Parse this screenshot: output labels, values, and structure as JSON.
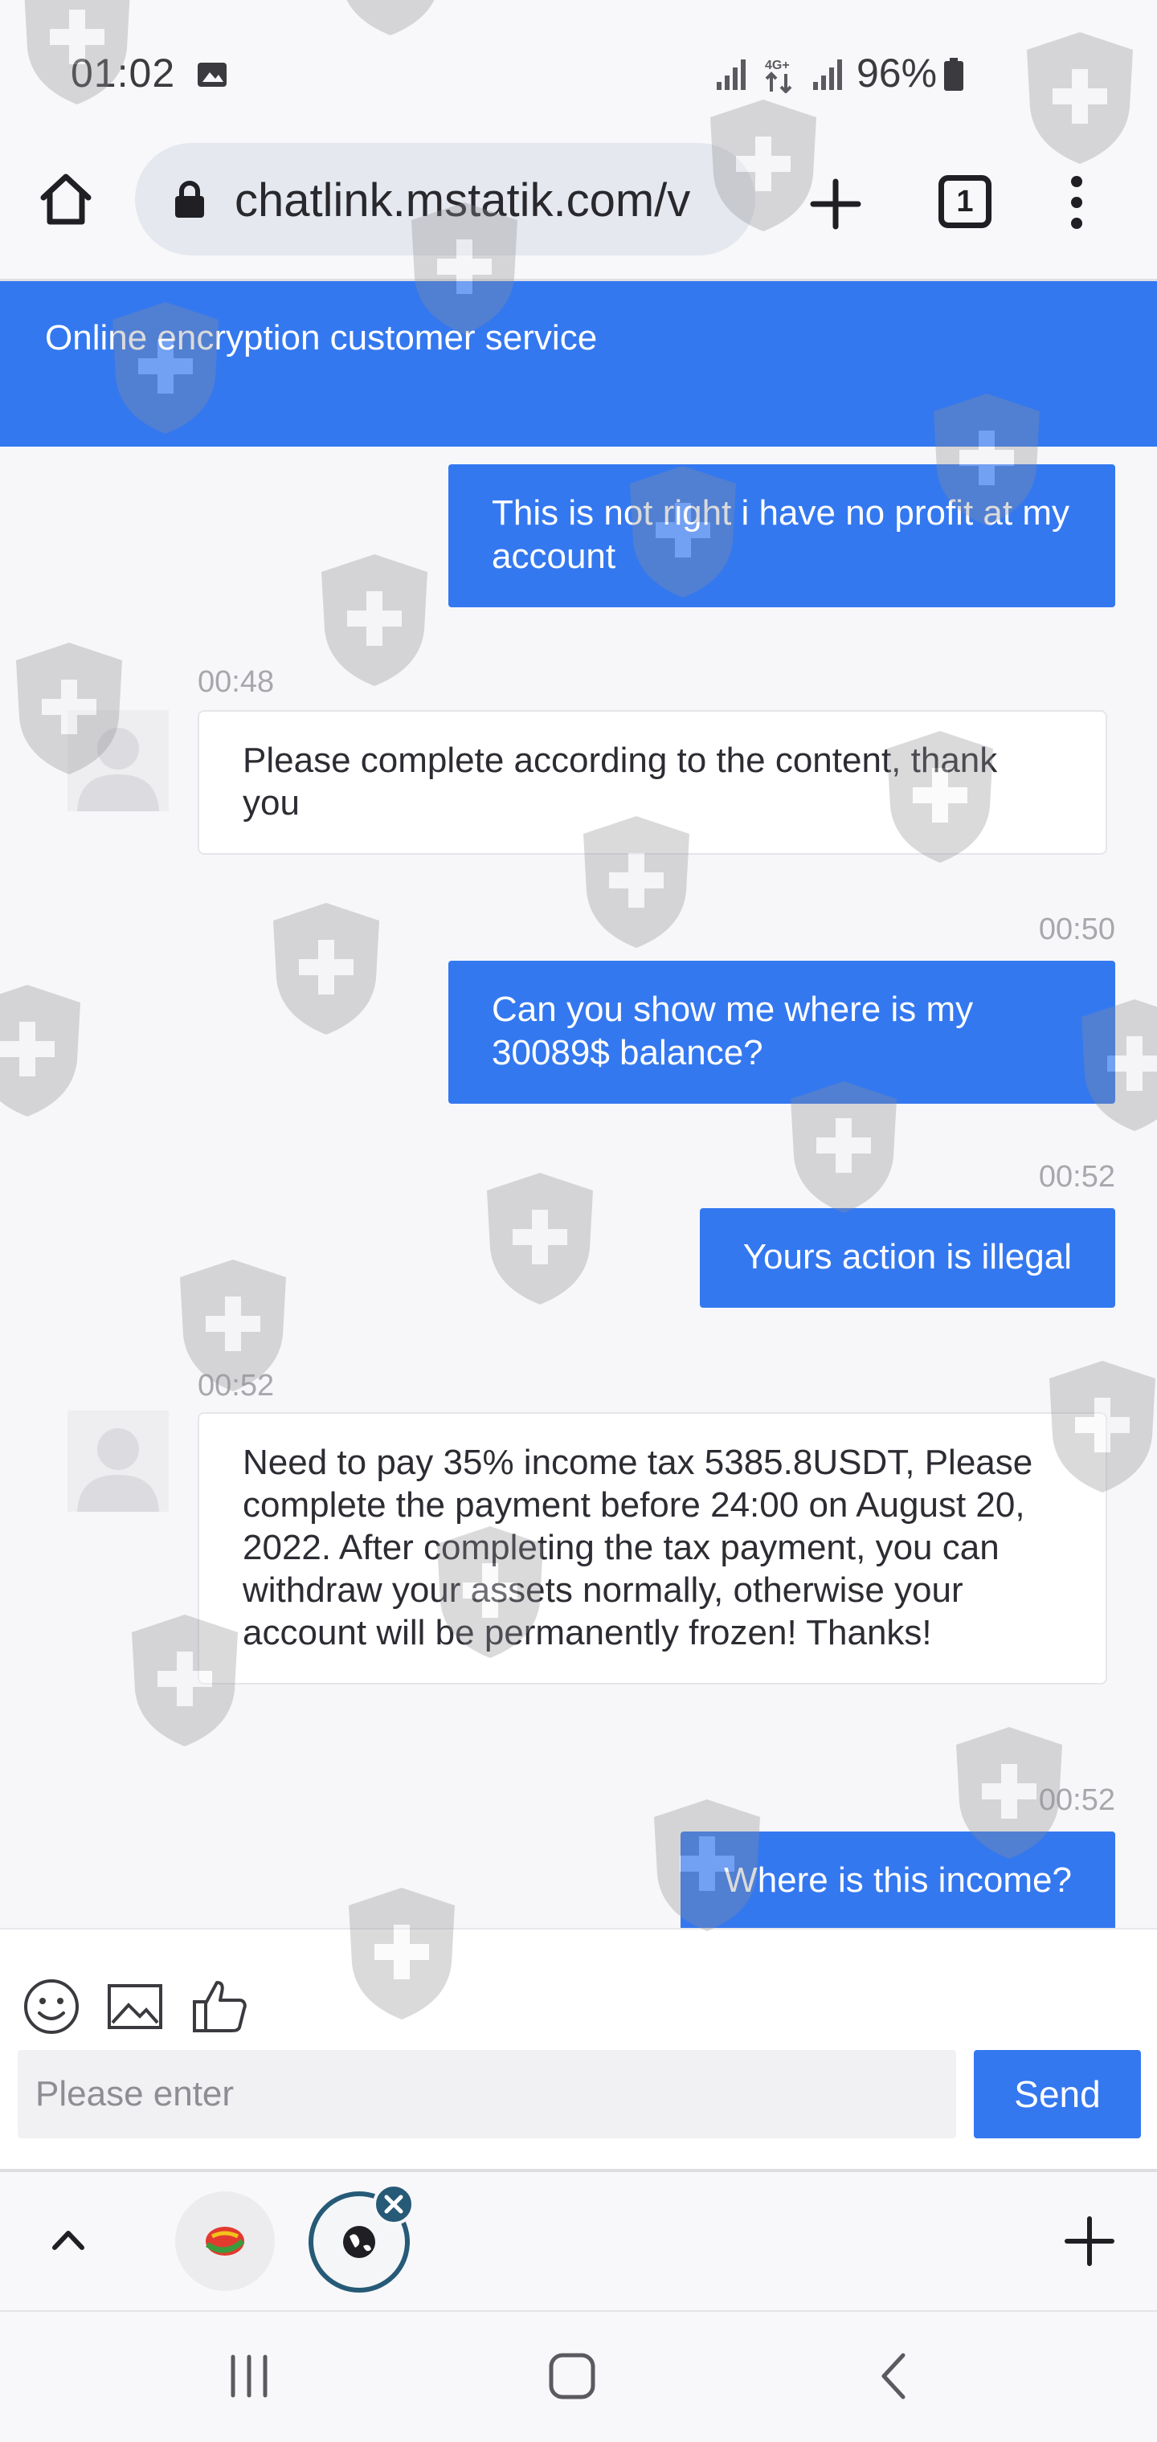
{
  "status_bar": {
    "time": "01:02",
    "battery": "96%",
    "icons": [
      "image-icon",
      "signal-icon",
      "4g-lte-icon",
      "signal-icon",
      "battery-icon"
    ]
  },
  "browser": {
    "url": "chatlink.mstatik.com/v",
    "tab_count": "1",
    "icons": [
      "home-icon",
      "lock-icon",
      "plus-icon",
      "more-vert-icon"
    ]
  },
  "chat": {
    "header_title": "Online encryption customer service",
    "messages": [
      {
        "side": "out",
        "time": "",
        "text": "This is not right i have no profit at my account"
      },
      {
        "side": "in",
        "time": "00:48",
        "text": "Please complete according to the content, thank you"
      },
      {
        "side": "out",
        "time": "00:50",
        "text": "Can you show me where is my 30089$ balance?"
      },
      {
        "side": "out",
        "time": "00:52",
        "text": "Yours action is illegal"
      },
      {
        "side": "in",
        "time": "00:52",
        "text": "Need to pay 35% income tax 5385.8USDT, Please complete the payment before 24:00 on August 20, 2022. After completing the tax payment, you can withdraw your assets normally, otherwise your account will be permanently frozen! Thanks!"
      },
      {
        "side": "out",
        "time": "00:52",
        "text": "Where is this income?"
      }
    ]
  },
  "composer": {
    "placeholder": "Please enter",
    "send_label": "Send",
    "icons": [
      "emoji-icon",
      "image-icon",
      "thumbs-up-icon"
    ]
  },
  "tab_strip": {
    "icons": [
      "chevron-up-icon",
      "site-favicon-icon",
      "globe-icon",
      "close-icon",
      "plus-icon"
    ]
  },
  "nav": {
    "icons": [
      "recent-apps-icon",
      "home-icon",
      "back-icon"
    ]
  },
  "colors": {
    "accent": "#3478f0",
    "tab_ring": "#265a77"
  }
}
